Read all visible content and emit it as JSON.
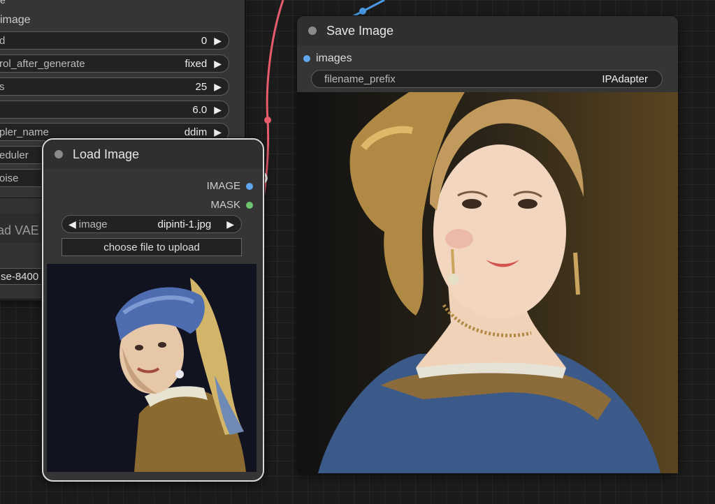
{
  "sampler_node": {
    "partial_label_top": "e",
    "image_label": "image",
    "widgets": [
      {
        "name": "d",
        "value": "0"
      },
      {
        "name": "rol_after_generate",
        "value": "fixed"
      },
      {
        "name": "s",
        "value": "25"
      },
      {
        "name": "",
        "value": "6.0"
      },
      {
        "name": "pler_name",
        "value": "ddim"
      },
      {
        "name": "eduler",
        "value": ""
      },
      {
        "name": "oise",
        "value": ""
      }
    ]
  },
  "vae_node": {
    "title": "ad VAE",
    "widget_value": "se-8400"
  },
  "load_image": {
    "title": "Load Image",
    "outputs": [
      {
        "label": "IMAGE",
        "color": "#5fa8f0"
      },
      {
        "label": "MASK",
        "color": "#6dc66d"
      }
    ],
    "image_widget": {
      "name": "image",
      "value": "dipinti-1.jpg"
    },
    "upload_button": "choose file to upload"
  },
  "save_image": {
    "title": "Save Image",
    "input_label": "images",
    "input_color": "#5fa8f0",
    "filename_prefix": {
      "name": "filename_prefix",
      "value": "IPAdapter"
    }
  },
  "colors": {
    "link_red": "#e65c6c",
    "link_blue": "#4a9ae6"
  }
}
